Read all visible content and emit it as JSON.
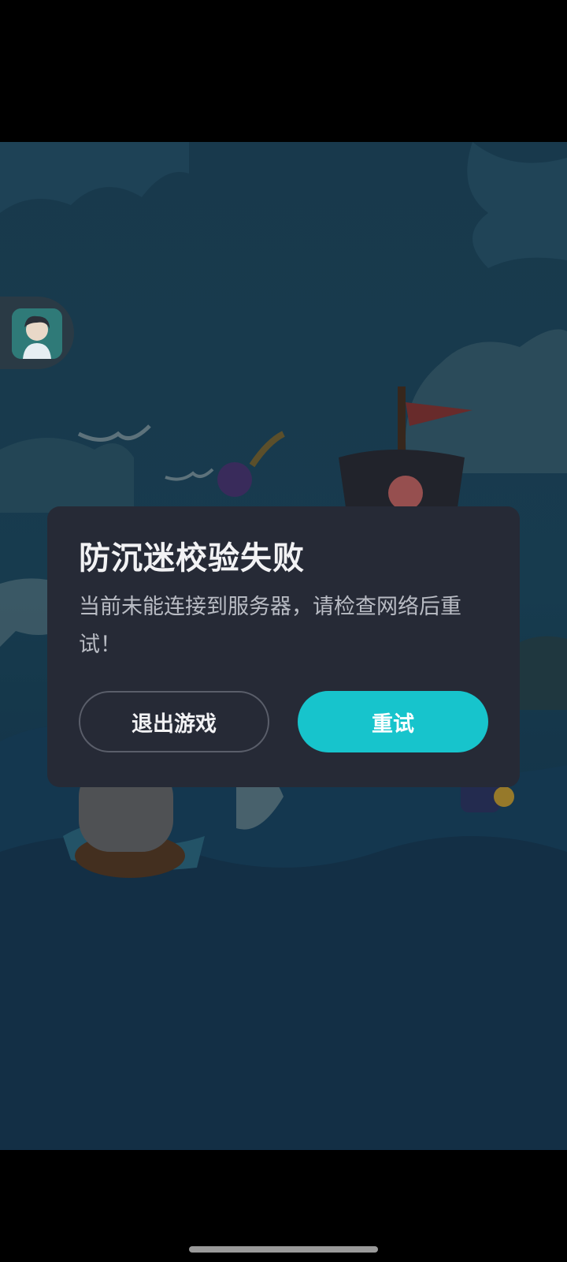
{
  "dialog": {
    "title": "防沉迷校验失败",
    "message": "当前未能连接到服务器，请检查网络后重试！",
    "exit_label": "退出游戏",
    "retry_label": "重试"
  },
  "colors": {
    "dialog_bg": "#262a36",
    "retry_button": "#17c4cc",
    "exit_border": "#5a5e6a",
    "sky": "#214d66",
    "sea": "#1a4560"
  },
  "icons": {
    "avatar": "player-avatar",
    "background": "pirate-ship-scene"
  }
}
